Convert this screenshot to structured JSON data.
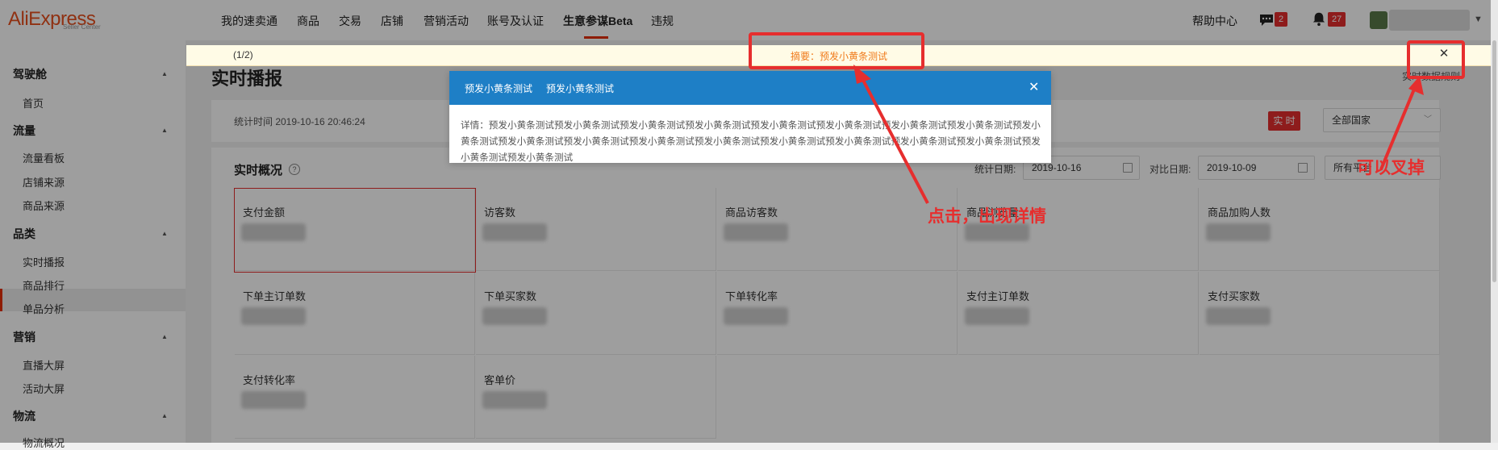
{
  "app": {
    "logo": "AliExpress",
    "logo_sub": "Seller Center"
  },
  "nav": {
    "items": [
      "我的速卖通",
      "商品",
      "交易",
      "店铺",
      "营销活动",
      "账号及认证",
      "生意参谋Beta",
      "违规"
    ],
    "active_index": 6,
    "help": "帮助中心",
    "messages_count": "2",
    "notifications_count": "27"
  },
  "sidebar": {
    "groups": [
      {
        "title": "驾驶舱",
        "items": [
          "首页"
        ]
      },
      {
        "title": "流量",
        "items": [
          "流量看板",
          "店铺来源",
          "商品来源"
        ]
      },
      {
        "title": "品类",
        "items": [
          "实时播报",
          "商品排行",
          "单品分析"
        ]
      },
      {
        "title": "营销",
        "items": [
          "直播大屏",
          "活动大屏"
        ]
      },
      {
        "title": "物流",
        "items": [
          "物流概况"
        ]
      }
    ],
    "active_item": "实时播报"
  },
  "main": {
    "title": "实时播报",
    "stat_time": "统计时间 2019-10-16 20:46:24",
    "realtime_button": "实 时",
    "country_select": "全部国家",
    "overview_title": "实时概况",
    "stat_date_label": "统计日期:",
    "stat_date": "2019-10-16",
    "compare_date_label": "对比日期:",
    "compare_date": "2019-10-09",
    "platform_select": "所有平台",
    "top_right_link": "实时数据规则",
    "metrics": [
      "支付金额",
      "访客数",
      "商品访客数",
      "商品浏览量",
      "商品加购人数",
      "下单主订单数",
      "下单买家数",
      "下单转化率",
      "支付主订单数",
      "支付买家数",
      "支付转化率",
      "客单价"
    ]
  },
  "notice": {
    "count": "(1/2)",
    "summary": "摘要：预发小黄条测试"
  },
  "modal": {
    "tab1": "预发小黄条测试",
    "tab2": "预发小黄条测试",
    "body": "详情：预发小黄条测试预发小黄条测试预发小黄条测试预发小黄条测试预发小黄条测试预发小黄条测试预发小黄条测试预发小黄条测试预发小黄条测试预发小黄条测试预发小黄条测试预发小黄条测试预发小黄条测试预发小黄条测试预发小黄条测试预发小黄条测试预发小黄条测试预发小黄条测试预发小黄条测试"
  },
  "annotations": {
    "click_text": "点击，出现详情",
    "close_text": "可以叉掉"
  },
  "colors": {
    "brand": "#e8501e",
    "accent_red": "#e62e2e",
    "modal_blue": "#1e7fc6",
    "notice_orange": "#f07b1c"
  }
}
